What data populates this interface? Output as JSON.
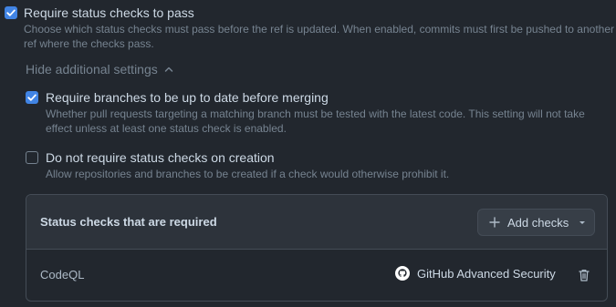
{
  "settings": {
    "require_status_checks": {
      "label": "Require status checks to pass",
      "description": "Choose which status checks must pass before the ref is updated. When enabled, commits must first be pushed to another ref where the checks pass.",
      "checked": true
    },
    "toggle_link": {
      "label": "Hide additional settings",
      "icon": "chevron-up-icon"
    },
    "require_up_to_date": {
      "label": "Require branches to be up to date before merging",
      "description": "Whether pull requests targeting a matching branch must be tested with the latest code. This setting will not take effect unless at least one status check is enabled.",
      "checked": true
    },
    "no_check_on_creation": {
      "label": "Do not require status checks on creation",
      "description": "Allow repositories and branches to be created if a check would otherwise prohibit it.",
      "checked": false
    }
  },
  "status_checks": {
    "title": "Status checks that are required",
    "add_button_label": "Add checks",
    "rows": [
      {
        "name": "CodeQL",
        "provider": "GitHub Advanced Security",
        "provider_icon": "github-icon",
        "action_icon": "trash-icon"
      }
    ]
  },
  "colors": {
    "background": "#22272e",
    "accent_checkbox": "#4184e4",
    "muted_text": "#768390",
    "primary_text": "#cdd9e5",
    "border": "#444c56"
  }
}
